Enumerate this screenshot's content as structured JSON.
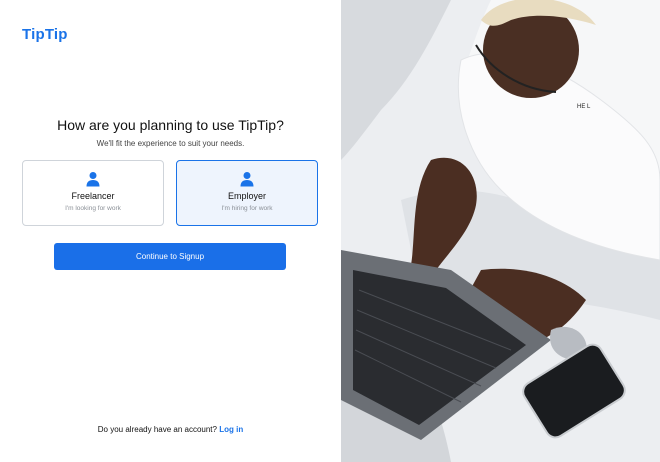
{
  "brand": {
    "logo": "TipTip",
    "color": "#1a73e8"
  },
  "heading": "How are you planning to use TipTip?",
  "subheading": "We'll fit the experience to suit your needs.",
  "options": [
    {
      "title": "Freelancer",
      "description": "I'm looking for work",
      "selected": false,
      "icon": "person-icon"
    },
    {
      "title": "Employer",
      "description": "I'm hiring for work",
      "selected": true,
      "icon": "person-icon"
    }
  ],
  "cta": {
    "label": "Continue to Signup"
  },
  "footer": {
    "prompt": "Do you already have an account?",
    "link": "Log in"
  },
  "hero_image": {
    "description_icon": "photo-person-laptop-bed"
  }
}
